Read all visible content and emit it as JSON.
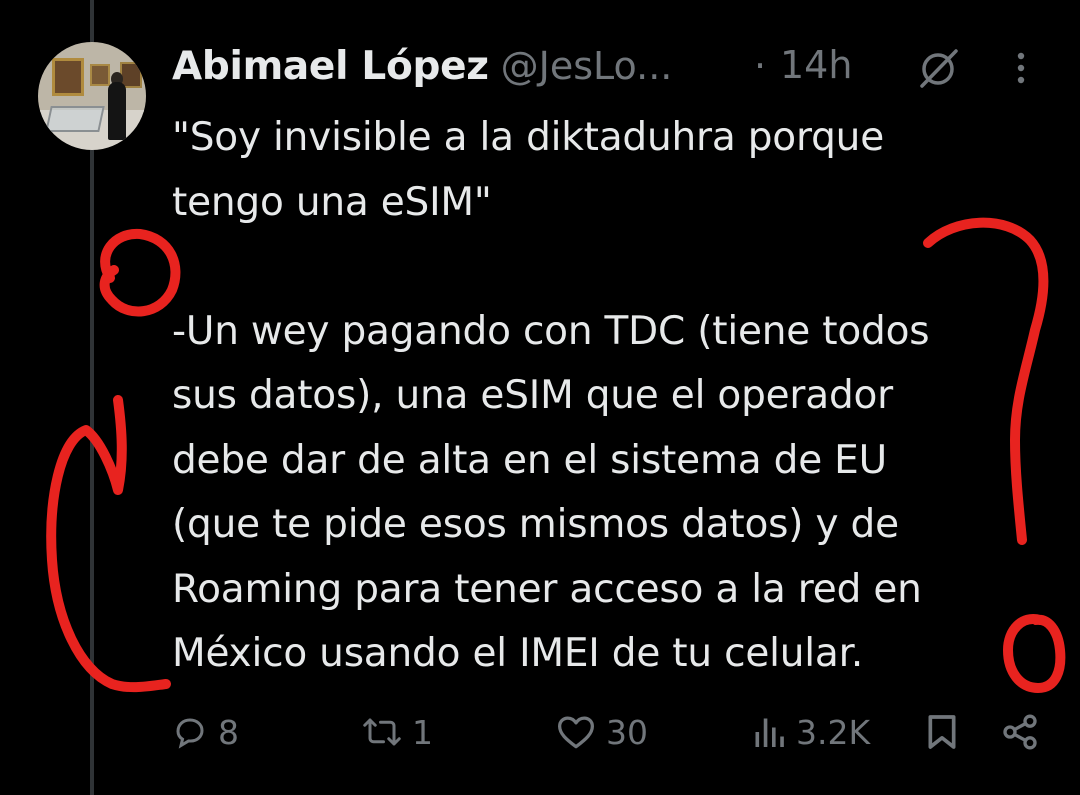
{
  "tweet": {
    "display_name": "Abimael López",
    "handle": "@JesLo...",
    "separator": "·",
    "time": "14h",
    "text": "\"Soy invisible a la diktaduhra porque\ntengo una eSIM\"\n\n-Un wey pagando con TDC (tiene todos\nsus datos), una eSIM que el operador\ndebe dar de alta en el sistema de EU\n(que te pide esos mismos datos)  y de\nRoaming para tener acceso a la red en\nMéxico usando el IMEI de tu celular."
  },
  "actions": {
    "replies": "8",
    "reposts": "1",
    "likes": "30",
    "views": "3.2K"
  },
  "icons": {
    "grok": "grok-icon",
    "more": "more-options-icon",
    "reply": "reply-icon",
    "repost": "repost-icon",
    "like": "like-icon",
    "views": "views-icon",
    "bookmark": "bookmark-icon",
    "share": "share-icon"
  },
  "colors": {
    "background": "#000000",
    "text": "#e7e9ea",
    "secondary": "#71767b",
    "annotation_red": "#e8231f",
    "thread_line": "#2f3336"
  }
}
